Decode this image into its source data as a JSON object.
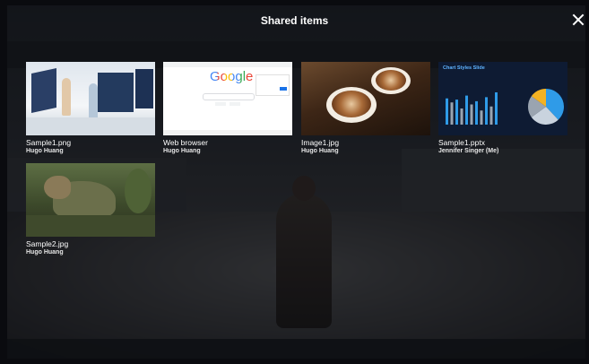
{
  "dialog": {
    "title": "Shared items",
    "close_icon": "close-icon"
  },
  "items": [
    {
      "name": "Sample1.png",
      "owner": "Hugo Huang",
      "thumbnail": "image-thumbnail"
    },
    {
      "name": "Web browser",
      "owner": "Hugo Huang",
      "thumbnail": "browser-thumbnail"
    },
    {
      "name": "Image1.jpg",
      "owner": "Hugo Huang",
      "thumbnail": "image-thumbnail"
    },
    {
      "name": "Sample1.pptx",
      "owner": "Jennifer Singer (Me)",
      "thumbnail": "slide-thumbnail"
    },
    {
      "name": "Sample2.jpg",
      "owner": "Hugo Huang",
      "thumbnail": "image-thumbnail"
    }
  ],
  "browser_thumb": {
    "logo": "Google"
  },
  "slide_thumb": {
    "title": "Chart Styles Slide",
    "bar_values": [
      0.65,
      0.55,
      0.62,
      0.4,
      0.72,
      0.5,
      0.58,
      0.35,
      0.68,
      0.45,
      0.8
    ],
    "pie": [
      0.38,
      0.27,
      0.2,
      0.15
    ],
    "colors": {
      "blue": "#2f9be8",
      "gray": "#9aa4b0",
      "yellow": "#f3b223",
      "light": "#c9d3de"
    }
  }
}
